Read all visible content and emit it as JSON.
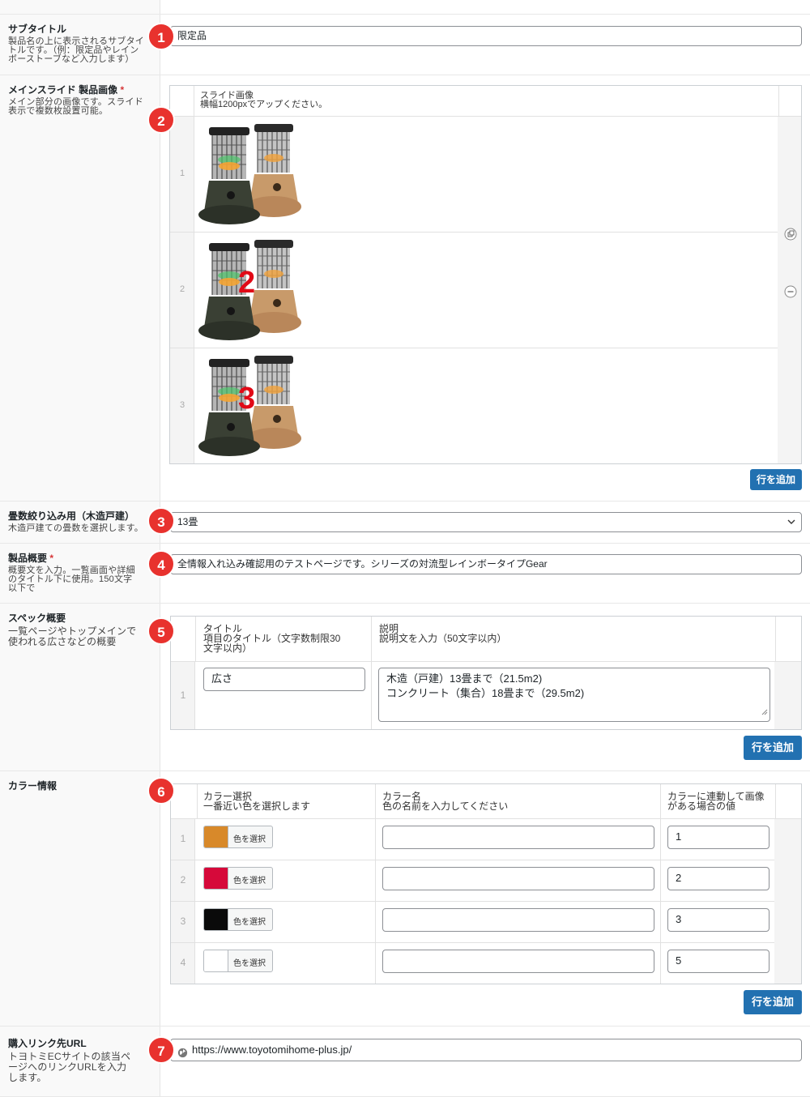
{
  "fields": {
    "subtitle": {
      "badge": "1",
      "title": "サブタイトル",
      "desc": [
        "製品名の上に表示されるサブタイ",
        "トルです。（例：限定品やレイン",
        "ボーストーブなど入力します）"
      ],
      "value": "限定品"
    },
    "main_slide": {
      "badge": "2",
      "title": "メインスライド 製品画像",
      "required": "*",
      "desc": [
        "メイン部分の画像です。スライド",
        "表示で複数枚設置可能。"
      ],
      "col_title": "スライド画像",
      "col_desc": "横幅1200pxでアップください。",
      "rows": [
        {
          "num": "1",
          "overlay": ""
        },
        {
          "num": "2",
          "overlay": "2"
        },
        {
          "num": "3",
          "overlay": "3"
        }
      ],
      "add_row": "行を追加"
    },
    "tatami": {
      "badge": "3",
      "title": "畳数絞り込み用（木造戸建）",
      "desc": [
        "木造戸建ての畳数を選択します。"
      ],
      "value": "13畳"
    },
    "overview": {
      "badge": "4",
      "title": "製品概要",
      "required": "*",
      "desc": [
        "概要文を入力。一覧画面や詳細",
        "のタイトル下に使用。150文字",
        "以下で"
      ],
      "value": "全情報入れ込み確認用のテストページです。シリーズの対流型レインボータイプGear"
    },
    "spec": {
      "badge": "5",
      "title": "スペック概要",
      "desc": [
        "一覧ページやトップメインで",
        "使われる広さなどの概要"
      ],
      "col1_title": "タイトル",
      "col1_desc": [
        "項目のタイトル（文字数制限30",
        "文字以内）"
      ],
      "col2_title": "説明",
      "col2_desc": "説明文を入力（50文字以内）",
      "rows": [
        {
          "num": "1",
          "title": "広さ",
          "desc": [
            "木造（戸建）13畳まで（21.5m2)",
            "コンクリート（集合）18畳まで（29.5m2)"
          ]
        }
      ],
      "add_row": "行を追加"
    },
    "color": {
      "badge": "6",
      "title": "カラー情報",
      "col1_title": "カラー選択",
      "col1_desc": "一番近い色を選択します",
      "col2_title": "カラー名",
      "col2_desc": "色の名前を入力してください",
      "col3_title": "カラーに連動して画像",
      "col3_desc": "がある場合の値",
      "rows": [
        {
          "num": "1",
          "swatch": "#d8892a",
          "button": "色を選択",
          "name": "",
          "value": "1"
        },
        {
          "num": "2",
          "swatch": "#d6093a",
          "button": "色を選択",
          "name": "",
          "value": "2"
        },
        {
          "num": "3",
          "swatch": "#0a0a0a",
          "button": "色を選択",
          "name": "",
          "value": "3"
        },
        {
          "num": "4",
          "swatch": "#ffffff",
          "button": "色を選択",
          "name": "",
          "value": "5"
        }
      ],
      "add_row": "行を追加"
    },
    "purchase": {
      "badge": "7",
      "title": "購入リンク先URL",
      "desc": [
        "トヨトミECサイトの該当ペ",
        "ージへのリンクURLを入力",
        "します。"
      ],
      "value": "https://www.toyotomihome-plus.jp/"
    }
  },
  "colors": {
    "badge": "#e8322e",
    "button": "#2271b1",
    "required": "#d63638"
  }
}
